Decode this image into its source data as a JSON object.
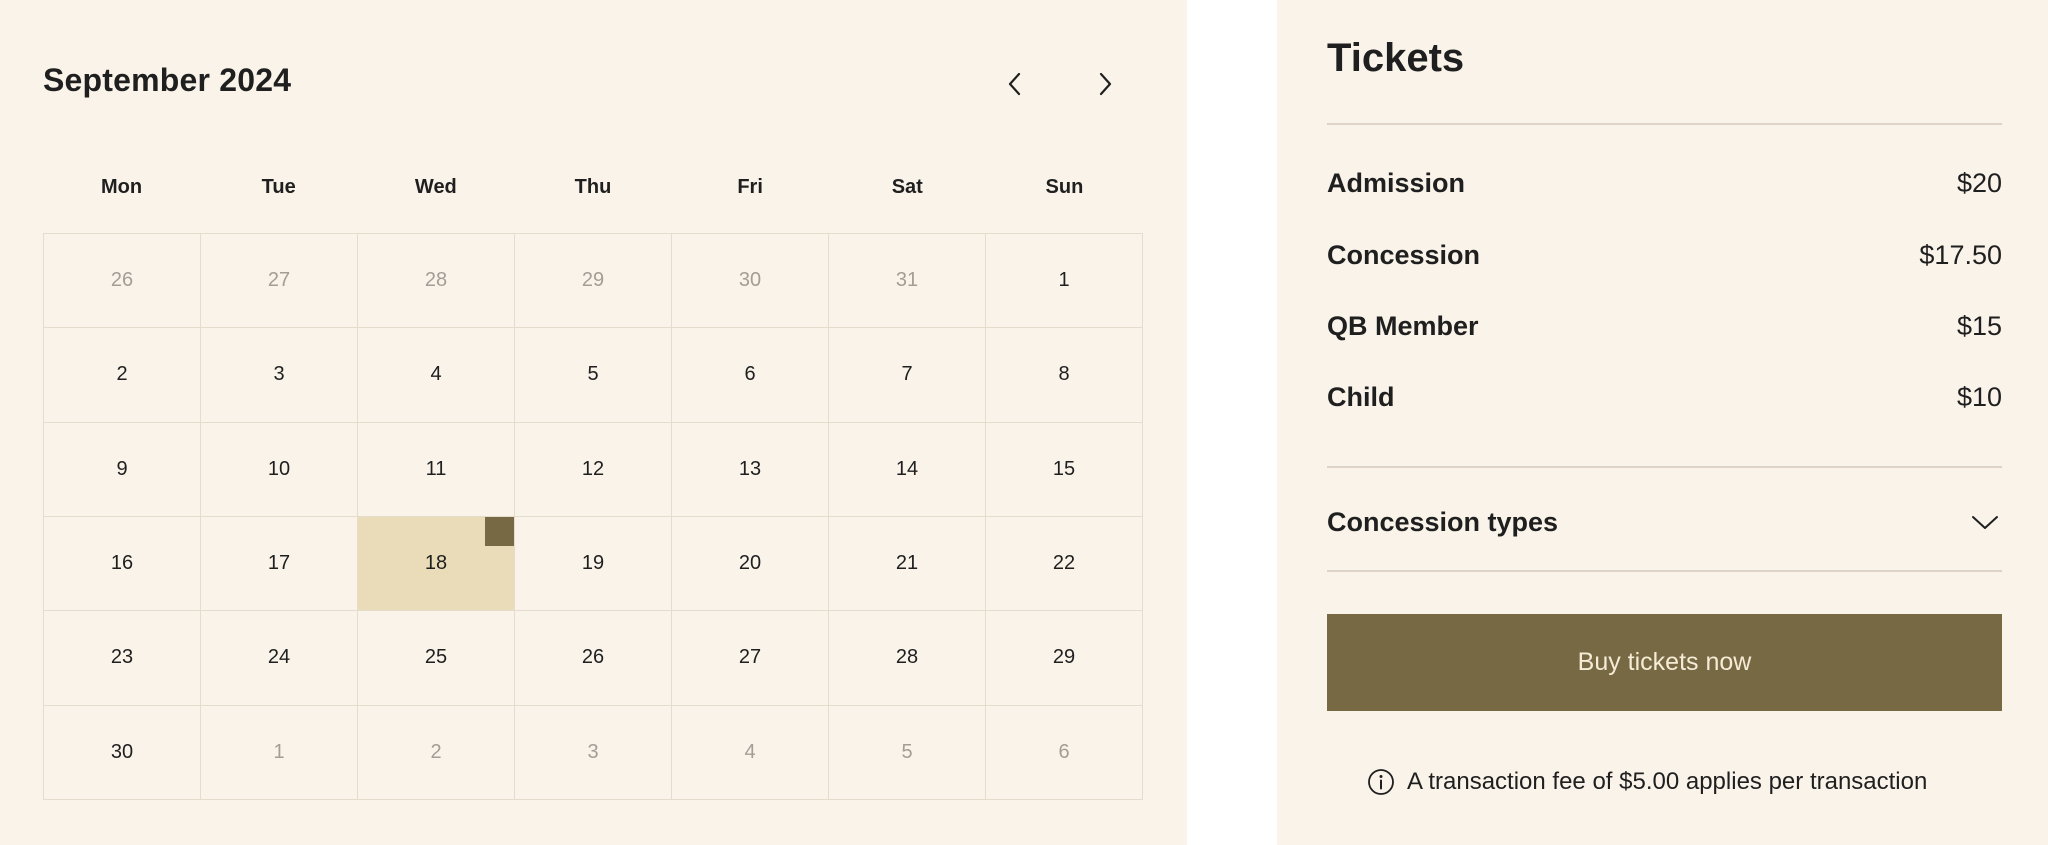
{
  "calendar": {
    "month_label": "September 2024",
    "prev_icon": "chevron-left-icon",
    "next_icon": "chevron-right-icon",
    "weekdays": [
      "Mon",
      "Tue",
      "Wed",
      "Thu",
      "Fri",
      "Sat",
      "Sun"
    ],
    "weeks": [
      [
        {
          "day": "26",
          "muted": true
        },
        {
          "day": "27",
          "muted": true
        },
        {
          "day": "28",
          "muted": true
        },
        {
          "day": "29",
          "muted": true
        },
        {
          "day": "30",
          "muted": true
        },
        {
          "day": "31",
          "muted": true
        },
        {
          "day": "1",
          "muted": false
        }
      ],
      [
        {
          "day": "2",
          "muted": false
        },
        {
          "day": "3",
          "muted": false
        },
        {
          "day": "4",
          "muted": false
        },
        {
          "day": "5",
          "muted": false
        },
        {
          "day": "6",
          "muted": false
        },
        {
          "day": "7",
          "muted": false
        },
        {
          "day": "8",
          "muted": false
        }
      ],
      [
        {
          "day": "9",
          "muted": false
        },
        {
          "day": "10",
          "muted": false
        },
        {
          "day": "11",
          "muted": false
        },
        {
          "day": "12",
          "muted": false
        },
        {
          "day": "13",
          "muted": false
        },
        {
          "day": "14",
          "muted": false
        },
        {
          "day": "15",
          "muted": false
        }
      ],
      [
        {
          "day": "16",
          "muted": false
        },
        {
          "day": "17",
          "muted": false
        },
        {
          "day": "18",
          "muted": false,
          "selected": true
        },
        {
          "day": "19",
          "muted": false
        },
        {
          "day": "20",
          "muted": false
        },
        {
          "day": "21",
          "muted": false
        },
        {
          "day": "22",
          "muted": false
        }
      ],
      [
        {
          "day": "23",
          "muted": false
        },
        {
          "day": "24",
          "muted": false
        },
        {
          "day": "25",
          "muted": false
        },
        {
          "day": "26",
          "muted": false
        },
        {
          "day": "27",
          "muted": false
        },
        {
          "day": "28",
          "muted": false
        },
        {
          "day": "29",
          "muted": false
        }
      ],
      [
        {
          "day": "30",
          "muted": false
        },
        {
          "day": "1",
          "muted": true
        },
        {
          "day": "2",
          "muted": true
        },
        {
          "day": "3",
          "muted": true
        },
        {
          "day": "4",
          "muted": true
        },
        {
          "day": "5",
          "muted": true
        },
        {
          "day": "6",
          "muted": true
        }
      ]
    ],
    "colors": {
      "background": "#f9f3ea",
      "selected_bg": "#eadcb8",
      "selected_marker": "#786945",
      "muted_text": "#a29d96",
      "grid_line": "#e5dccd"
    }
  },
  "tickets": {
    "title": "Tickets",
    "prices": [
      {
        "label": "Admission",
        "amount": "$20"
      },
      {
        "label": "Concession",
        "amount": "$17.50"
      },
      {
        "label": "QB Member",
        "amount": "$15"
      },
      {
        "label": "Child",
        "amount": "$10"
      }
    ],
    "concession_types_label": "Concession types",
    "concession_types_icon": "chevron-down-icon",
    "buy_button_label": "Buy tickets now",
    "fee_note": "A transaction fee of $5.00 applies per transaction",
    "fee_icon": "info-icon",
    "colors": {
      "button_bg": "#786945",
      "button_text": "#f5ecd6",
      "divider": "#ddd3c6"
    }
  }
}
